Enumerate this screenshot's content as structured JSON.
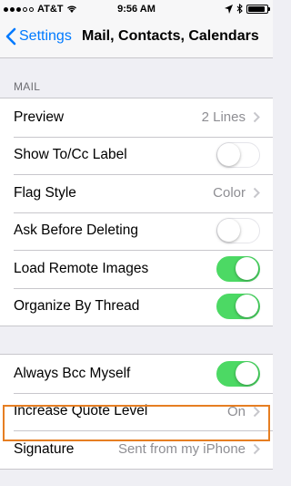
{
  "status_bar": {
    "carrier": "AT&T",
    "time": "9:56 AM",
    "battery_level": 0.9
  },
  "nav": {
    "back_label": "Settings",
    "title": "Mail, Contacts, Calendars"
  },
  "mail_section": {
    "header": "MAIL",
    "rows": [
      {
        "label": "Preview",
        "value": "2 Lines",
        "type": "detail"
      },
      {
        "label": "Show To/Cc Label",
        "type": "toggle",
        "on": false
      },
      {
        "label": "Flag Style",
        "value": "Color",
        "type": "detail"
      },
      {
        "label": "Ask Before Deleting",
        "type": "toggle",
        "on": false
      },
      {
        "label": "Load Remote Images",
        "type": "toggle",
        "on": true
      },
      {
        "label": "Organize By Thread",
        "type": "toggle",
        "on": true
      }
    ]
  },
  "compose_section": {
    "rows": [
      {
        "label": "Always Bcc Myself",
        "type": "toggle",
        "on": true
      },
      {
        "label": "Increase Quote Level",
        "value": "On",
        "type": "detail"
      },
      {
        "label": "Signature",
        "value": "Sent from my iPhone",
        "type": "detail"
      }
    ]
  },
  "colors": {
    "accent": "#007aff",
    "toggle_on": "#4cd964",
    "highlight": "#e67e22"
  }
}
